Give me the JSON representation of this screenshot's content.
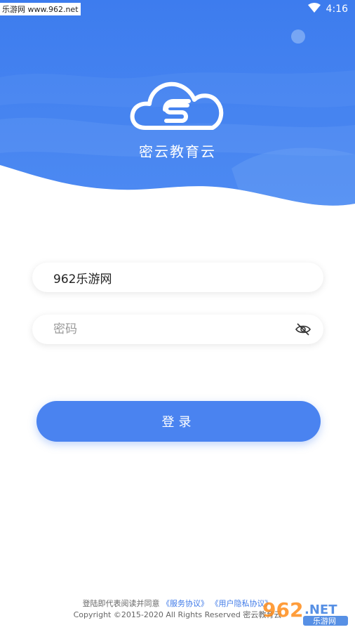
{
  "status": {
    "watermark": "乐游网 www.962.net",
    "time": "4:16"
  },
  "app": {
    "title": "密云教育云"
  },
  "username": {
    "value": "962乐游网"
  },
  "password": {
    "placeholder": "密码"
  },
  "login": {
    "label": "登录"
  },
  "footer": {
    "agree_prefix": "登陆即代表阅读并同意",
    "service_link": "《服务协议》",
    "privacy_link": "《用户隐私协议》",
    "copyright": "Copyright ©2015-2020 All Rights Reserved 密云教育云"
  },
  "brand_watermark": {
    "number": "962",
    "domain": ".NET",
    "text": "乐游网"
  },
  "colors": {
    "primary": "#4a83f0",
    "hero": "#3f80ee"
  }
}
